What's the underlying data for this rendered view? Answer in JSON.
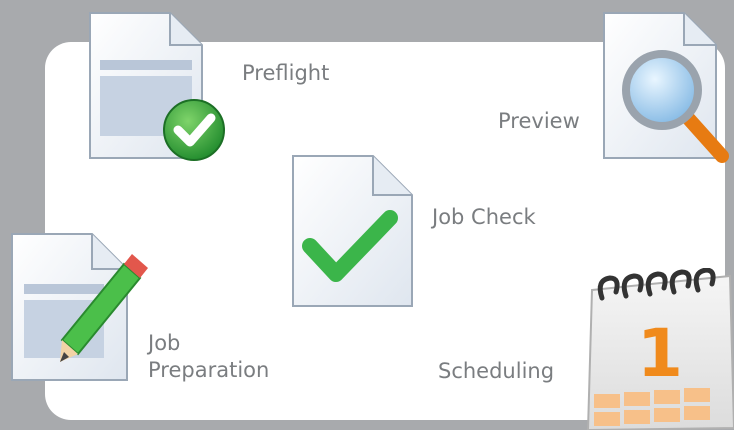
{
  "features": {
    "preflight": {
      "label": "Preflight"
    },
    "preview": {
      "label": "Preview"
    },
    "job_check": {
      "label": "Job Check"
    },
    "job_preparation": {
      "line1": "Job",
      "line2": "Preparation"
    },
    "scheduling": {
      "label": "Scheduling",
      "calendar_day": "1"
    }
  },
  "icons": {
    "preflight": "document-checkmark-badge-icon",
    "preview": "document-magnifier-icon",
    "job_check": "document-checkmark-icon",
    "job_preparation": "document-pencil-icon",
    "scheduling": "calendar-icon"
  },
  "colors": {
    "background": "#a8aaad",
    "panel": "#ffffff",
    "label_text": "#7a7d80",
    "check_green": "#3bb54a",
    "calendar_orange": "#f08a1c"
  }
}
